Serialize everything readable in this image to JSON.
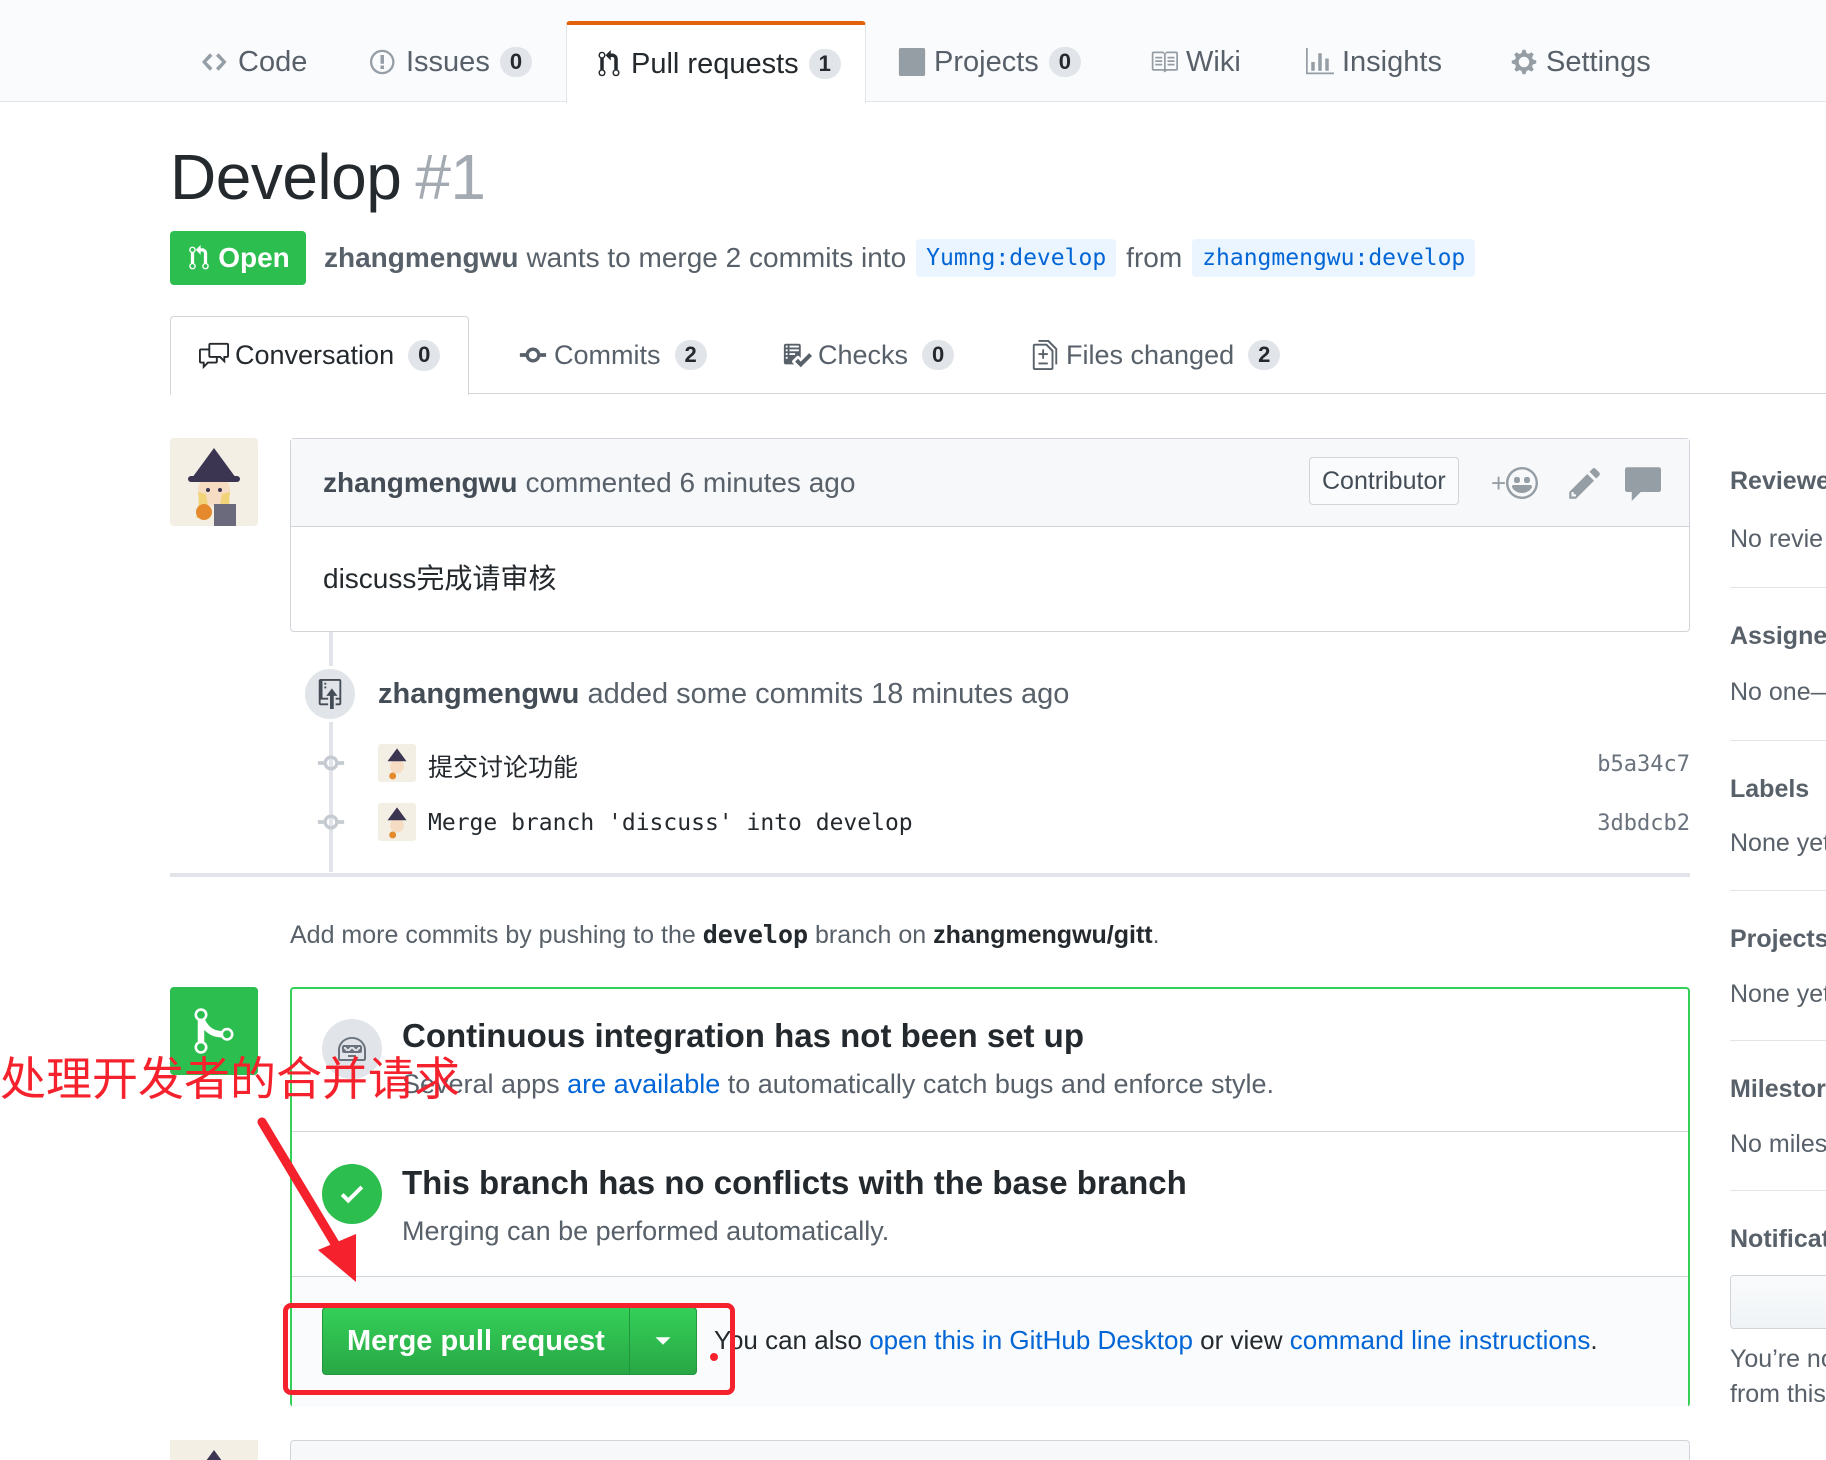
{
  "repo_nav": {
    "code": "Code",
    "issues": "Issues",
    "issues_count": "0",
    "pulls": "Pull requests",
    "pulls_count": "1",
    "projects": "Projects",
    "projects_count": "0",
    "wiki": "Wiki",
    "insights": "Insights",
    "settings": "Settings"
  },
  "pr": {
    "title": "Develop",
    "number": "#1",
    "state": "Open",
    "author": "zhangmengwu",
    "meta_text": "wants to merge 2 commits into",
    "base_branch": "Yumng:develop",
    "from_text": "from",
    "head_branch": "zhangmengwu:develop"
  },
  "pr_tabs": {
    "conversation": "Conversation",
    "conversation_count": "0",
    "commits": "Commits",
    "commits_count": "2",
    "checks": "Checks",
    "checks_count": "0",
    "files": "Files changed",
    "files_count": "2"
  },
  "comment": {
    "author": "zhangmengwu",
    "action": "commented 6 minutes ago",
    "role": "Contributor",
    "reaction_plus": "+",
    "body": "discuss完成请审核"
  },
  "timeline": {
    "author": "zhangmengwu",
    "action": "added some commits 18 minutes ago",
    "commits": [
      {
        "message": "提交讨论功能",
        "sha": "b5a34c7"
      },
      {
        "message": "Merge branch 'discuss' into develop",
        "sha": "3dbdcb2"
      }
    ]
  },
  "push_hint": {
    "prefix": "Add more commits by pushing to the",
    "branch": "develop",
    "middle": "branch on",
    "repo": "zhangmengwu/gitt",
    "suffix": "."
  },
  "merge_box": {
    "ci_title": "Continuous integration has not been set up",
    "ci_sub_prefix": "Several apps",
    "ci_sub_link": "are available",
    "ci_sub_suffix": "to automatically catch bugs and enforce style.",
    "ok_title": "This branch has no conflicts with the base branch",
    "ok_sub": "Merging can be performed automatically.",
    "merge_button": "Merge pull request",
    "alt_prefix": "You can also",
    "alt_link1": "open this in GitHub Desktop",
    "alt_middle": "or view",
    "alt_link2": "command line instructions",
    "alt_suffix": "."
  },
  "sidebar": {
    "reviewers": "Reviewe",
    "reviewers_value": "No revie",
    "assignees": "Assigne",
    "assignees_value": "No one—",
    "labels": "Labels",
    "labels_value": "None yet",
    "projects": "Projects",
    "projects_value": "None yet",
    "milestone": "Milestor",
    "milestone_value": "No miles",
    "notifications": "Notificat",
    "notif_line1": "You’re no",
    "notif_line2": "from this"
  },
  "annotation": {
    "text": "处理开发者的合并请求",
    "color": "#f5222d"
  },
  "colors": {
    "green": "#2cbe4e",
    "link": "#0366d6",
    "tab_accent": "#e36209"
  }
}
